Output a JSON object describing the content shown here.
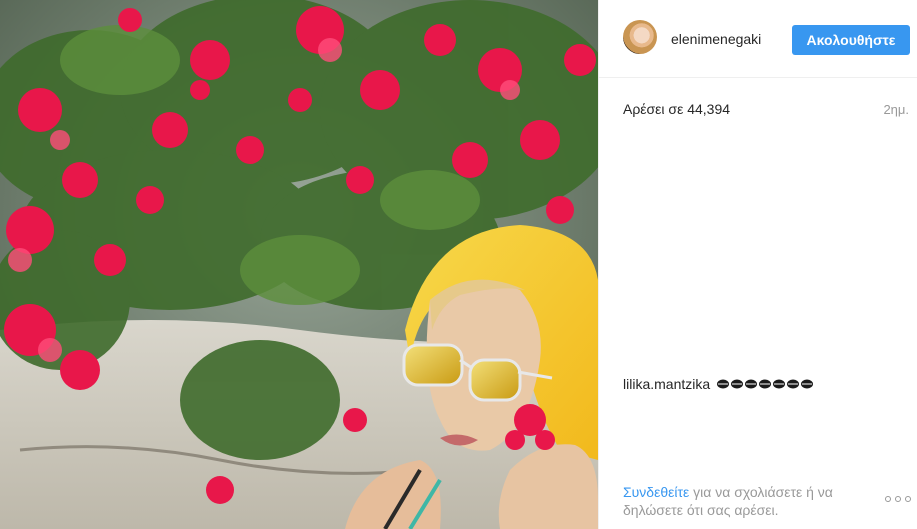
{
  "post": {
    "username": "elenimenegaki",
    "follow_label": "Ακολουθήστε",
    "likes_text": "Αρέσει σε 44,394",
    "time_text": "2ημ.",
    "photo_icon": "photo-image"
  },
  "comments": [
    {
      "author": "lilika.mantzika",
      "emoji": "kiss-mark-x7"
    }
  ],
  "footer": {
    "login_link": "Συνδεθείτε",
    "rest_text": " για να σχολιάσετε ή να δηλώσετε ότι σας αρέσει."
  },
  "colors": {
    "accent": "#3897f0",
    "text": "#262626",
    "muted": "#999999",
    "divider": "#efefef"
  }
}
